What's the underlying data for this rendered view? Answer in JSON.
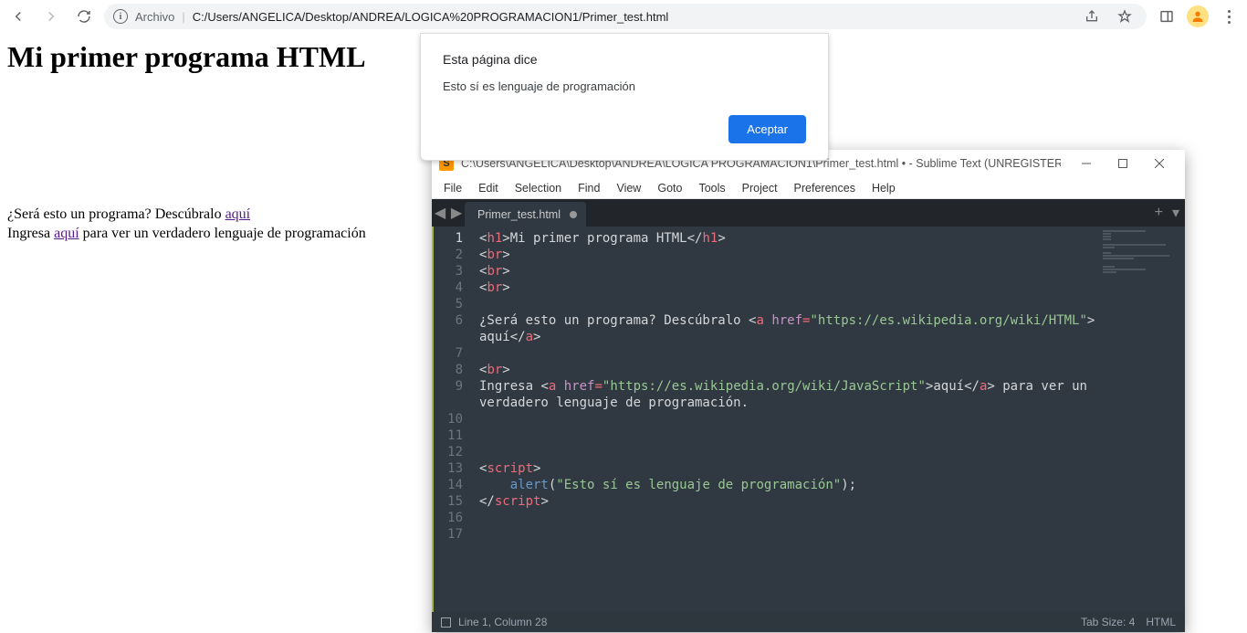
{
  "browser": {
    "address_label": "Archivo",
    "address_path": "C:/Users/ANGELICA/Desktop/ANDREA/LOGICA%20PROGRAMACION1/Primer_test.html"
  },
  "page": {
    "heading": "Mi primer programa HTML",
    "line1_pre": "¿Será esto un programa? Descúbralo ",
    "line1_link": "aquí",
    "line2_pre": "Ingresa ",
    "line2_link": "aquí",
    "line2_post": " para ver un verdadero lenguaje de programación"
  },
  "alert": {
    "title": "Esta página dice",
    "message": "Esto sí es lenguaje de programación",
    "accept": "Aceptar"
  },
  "sublime": {
    "title": "C:\\Users\\ANGELICA\\Desktop\\ANDREA\\LOGICA PROGRAMACION1\\Primer_test.html • - Sublime Text (UNREGISTERED)",
    "menu": [
      "File",
      "Edit",
      "Selection",
      "Find",
      "View",
      "Goto",
      "Tools",
      "Project",
      "Preferences",
      "Help"
    ],
    "tab": "Primer_test.html",
    "lines": [
      "1",
      "2",
      "3",
      "4",
      "5",
      "6",
      "7",
      "8",
      "9",
      "10",
      "11",
      "12",
      "13",
      "14",
      "15",
      "16",
      "17"
    ],
    "code": {
      "l1a": "<",
      "l1b": "h1",
      "l1c": ">",
      "l1d": "Mi primer programa HTML",
      "l1e": "</",
      "l1f": "h1",
      "l1g": ">",
      "br": "br",
      "l6a": "¿Será esto un programa? Descúbralo ",
      "l6b": "a",
      "l6c": "href",
      "l6d": "=",
      "l6e": "\"https://es.wikipedia.org/wiki/HTML\"",
      "l6f": "aquí",
      "l6g": "a",
      "l9a": "Ingresa ",
      "l9b": "a",
      "l9c": "href",
      "l9d": "=",
      "l9e": "\"https://es.wikipedia.org/wiki/JavaScript\"",
      "l9f": "aquí",
      "l9g": "a",
      "l9h": " para ver un ",
      "l9i": "verdadero lenguaje de programación.",
      "script": "script",
      "alertfn": "alert",
      "alertarg": "\"Esto sí es lenguaje de programación\""
    },
    "status_left": "Line 1, Column 28",
    "status_tab": "Tab Size: 4",
    "status_lang": "HTML"
  }
}
